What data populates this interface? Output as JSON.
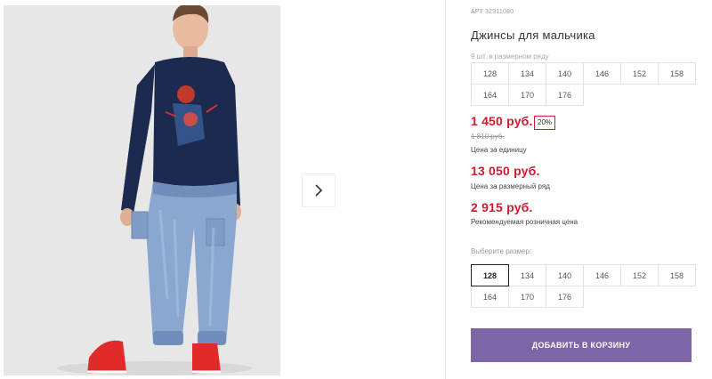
{
  "product": {
    "article": "АРТ 32311080",
    "title": "Джинсы для мальчика",
    "range_note": "9 шт. в размерном ряду",
    "range_sizes": [
      "128",
      "134",
      "140",
      "146",
      "152",
      "158",
      "164",
      "170",
      "176"
    ],
    "price": "1 450 руб.",
    "discount": "20%",
    "old_price": "1 810 руб.",
    "price_label": "Цена за единицу",
    "range_price": "13 050 руб.",
    "range_price_label": "Цена за размерный ряд",
    "retail_price": "2 915 руб.",
    "retail_price_label": "Рекомендуемая розничная цена",
    "choose_size_label": "Выберите размер:",
    "sizes": [
      "128",
      "134",
      "140",
      "146",
      "152",
      "158",
      "164",
      "170",
      "176"
    ],
    "selected_size": "128",
    "add_to_cart": "ДОБАВИТЬ В КОРЗИНУ"
  },
  "colors": {
    "accent": "#7d66a8",
    "price": "#d21a2f"
  },
  "icons": {
    "next": "chevron-right-icon"
  }
}
